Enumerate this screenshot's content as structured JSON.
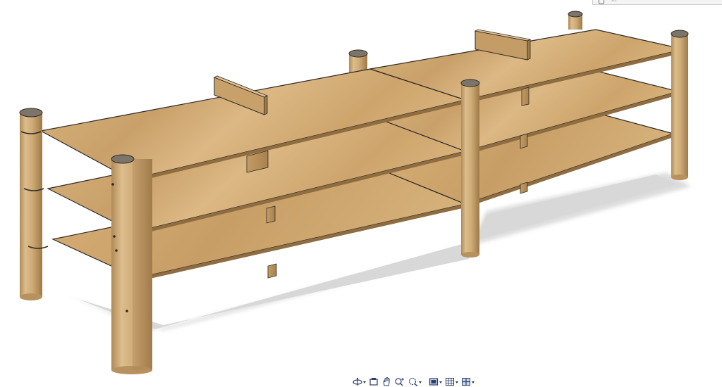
{
  "app": {
    "corner_panel_label": "···"
  },
  "model": {
    "description_text": "",
    "colors": {
      "board_light": "#dcb780",
      "board_mid": "#cfa86f",
      "board_dark": "#b38a52",
      "edge": "#2e2a25",
      "post_light": "#dcbd8c",
      "post_mid": "#c9a36e",
      "post_dark": "#a8824f",
      "post_top": "#7d7569",
      "shadow": "#dedede"
    }
  },
  "toolbar": {
    "buttons": [
      {
        "name": "orbit-tool-button",
        "icon": "orbit-icon",
        "has_menu": true
      },
      {
        "name": "look-at-button",
        "icon": "look-at-icon",
        "has_menu": false
      },
      {
        "name": "pan-button",
        "icon": "hand-pan-icon",
        "has_menu": false
      },
      {
        "name": "zoom-button",
        "icon": "zoom-plus-icon",
        "has_menu": false
      },
      {
        "name": "zoom-window-button",
        "icon": "zoom-window-icon",
        "has_menu": true
      },
      {
        "name": "display-mode-button",
        "icon": "display-mode-icon",
        "has_menu": true
      },
      {
        "name": "grid-button",
        "icon": "grid-icon",
        "has_menu": true
      },
      {
        "name": "viewports-button",
        "icon": "viewports-icon",
        "has_menu": true
      }
    ]
  }
}
